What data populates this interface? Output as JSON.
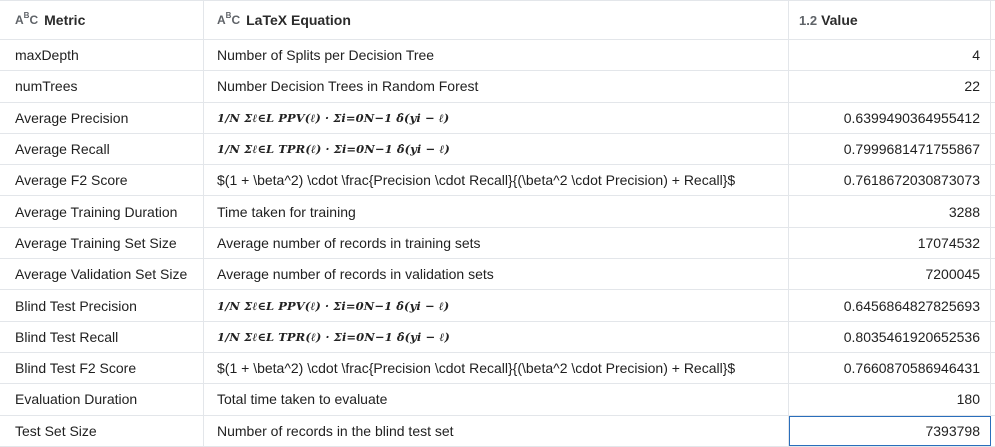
{
  "headers": {
    "metric": "Metric",
    "equation": "LaTeX Equation",
    "value": "Value",
    "text_type_icon": "ABC",
    "number_type_icon": "1.2"
  },
  "rows": [
    {
      "metric": "maxDepth",
      "equation": "Number of Splits per Decision Tree",
      "value": "4"
    },
    {
      "metric": "numTrees",
      "equation": "Number Decision Trees in Random Forest",
      "value": "22"
    },
    {
      "metric": "Average Precision",
      "equation": "1/N Σℓ∈L PPV(ℓ) · Σi=0N−1 δ̂(yi − ℓ)",
      "value": "0.6399490364955412"
    },
    {
      "metric": "Average Recall",
      "equation": "1/N Σℓ∈L TPR(ℓ) · Σi=0N−1 δ̂(yi − ℓ)",
      "value": "0.7999681471755867"
    },
    {
      "metric": "Average F2 Score",
      "equation": "$(1 + \\beta^2) \\cdot \\frac{Precision \\cdot Recall}{(\\beta^2 \\cdot Precision) + Recall}$",
      "value": "0.7618672030873073"
    },
    {
      "metric": "Average Training Duration",
      "equation": "Time taken for training",
      "value": "3288"
    },
    {
      "metric": "Average Training Set Size",
      "equation": "Average number of records in training sets",
      "value": "17074532"
    },
    {
      "metric": "Average Validation Set Size",
      "equation": "Average number of records in validation sets",
      "value": "7200045"
    },
    {
      "metric": "Blind Test Precision",
      "equation": "1/N Σℓ∈L PPV(ℓ) · Σi=0N−1 δ̂(yi − ℓ)",
      "value": "0.6456864827825693"
    },
    {
      "metric": "Blind Test Recall",
      "equation": "1/N Σℓ∈L TPR(ℓ) · Σi=0N−1 δ̂(yi − ℓ)",
      "value": "0.8035461920652536"
    },
    {
      "metric": "Blind Test F2 Score",
      "equation": "$(1 + \\beta^2) \\cdot \\frac{Precision \\cdot Recall}{(\\beta^2 \\cdot Precision) + Recall}$",
      "value": "0.7660870586946431"
    },
    {
      "metric": "Evaluation Duration",
      "equation": "Total time taken to evaluate",
      "value": "180"
    },
    {
      "metric": "Test Set Size",
      "equation": "Number of records in the blind test set",
      "value": "7393798"
    }
  ],
  "colors": {
    "grid_line": "#e3e6ea",
    "selection": "#2a6ebb",
    "icon": "#5f6368"
  }
}
